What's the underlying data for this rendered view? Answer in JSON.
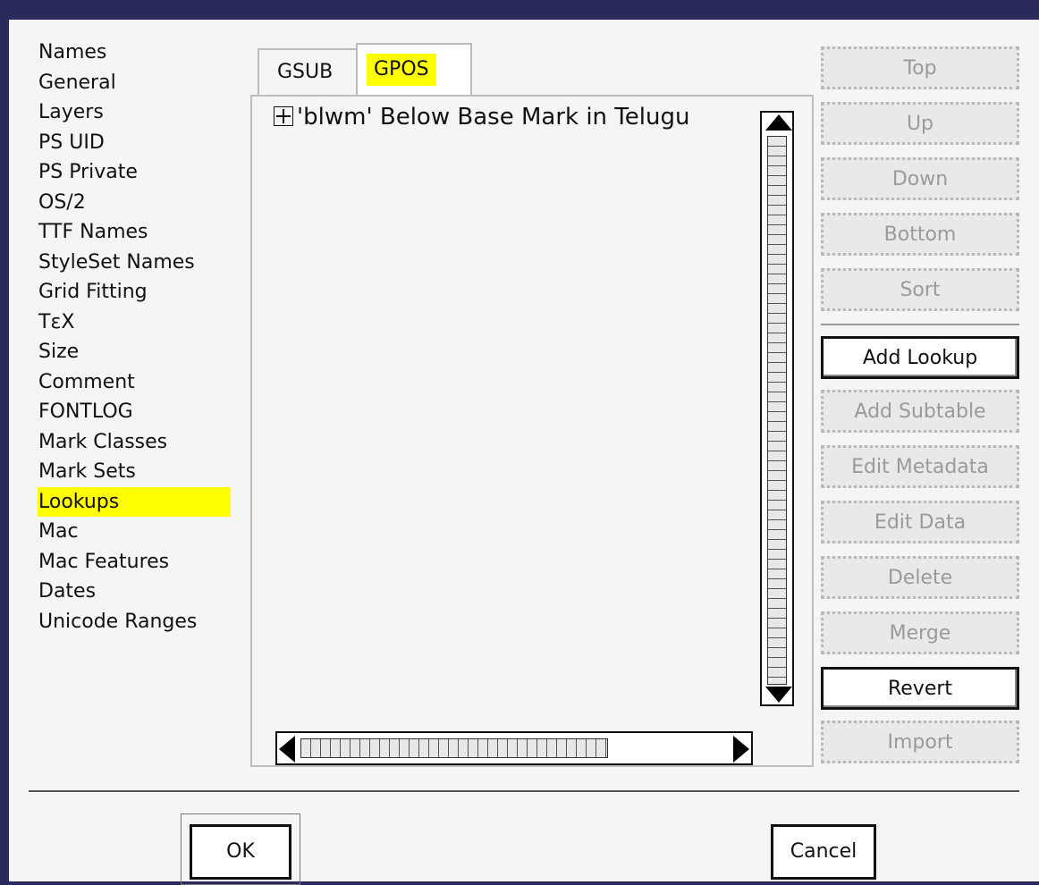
{
  "categories": [
    {
      "label": "Names"
    },
    {
      "label": "General"
    },
    {
      "label": "Layers"
    },
    {
      "label": "PS UID"
    },
    {
      "label": "PS Private"
    },
    {
      "label": "OS/2"
    },
    {
      "label": "TTF Names"
    },
    {
      "label": "StyleSet Names"
    },
    {
      "label": "Grid Fitting"
    },
    {
      "label": "TεX"
    },
    {
      "label": "Size"
    },
    {
      "label": "Comment"
    },
    {
      "label": "FONTLOG"
    },
    {
      "label": "Mark Classes"
    },
    {
      "label": "Mark Sets"
    },
    {
      "label": "Lookups",
      "selected": true
    },
    {
      "label": "Mac"
    },
    {
      "label": "Mac Features"
    },
    {
      "label": "Dates"
    },
    {
      "label": "Unicode Ranges"
    }
  ],
  "tabs": [
    {
      "label": "GSUB"
    },
    {
      "label": "GPOS",
      "active": true
    }
  ],
  "lookups": [
    {
      "label": "'blwm' Below Base Mark in Telugu"
    }
  ],
  "buttons": {
    "top": "Top",
    "up": "Up",
    "down": "Down",
    "bottom": "Bottom",
    "sort": "Sort",
    "add_lookup": "Add Lookup",
    "add_subtable": "Add Subtable",
    "edit_metadata": "Edit Metadata",
    "edit_data": "Edit Data",
    "delete": "Delete",
    "merge": "Merge",
    "revert": "Revert",
    "import": "Import"
  },
  "dialog": {
    "ok": "OK",
    "cancel": "Cancel"
  },
  "colors": {
    "highlight": "#ffff00",
    "frame": "#2a2a5c"
  }
}
